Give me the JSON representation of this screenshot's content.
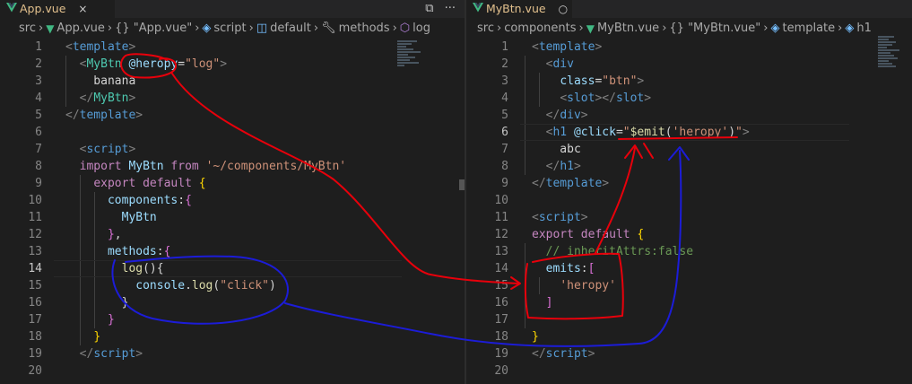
{
  "left": {
    "tab": {
      "label": "App.vue",
      "close": "×"
    },
    "actions": {
      "split": "⧉",
      "more": "···"
    },
    "breadcrumb": [
      "src",
      "App.vue",
      "{} \"App.vue\"",
      "script",
      "default",
      "methods",
      "log"
    ],
    "lines": [
      {
        "n": "1",
        "parts": [
          [
            "t-br",
            "<"
          ],
          [
            "t-tag",
            "template"
          ],
          [
            "t-br",
            ">"
          ]
        ]
      },
      {
        "n": "2",
        "parts": [
          [
            "t-txt",
            "  "
          ],
          [
            "t-br",
            "<"
          ],
          [
            "t-cmp",
            "MyBtn"
          ],
          [
            "t-txt",
            " "
          ],
          [
            "t-at",
            "@heropy"
          ],
          [
            "t-txt",
            "="
          ],
          [
            "t-str",
            "\"log\""
          ],
          [
            "t-br",
            ">"
          ]
        ]
      },
      {
        "n": "3",
        "parts": [
          [
            "t-txt",
            "    banana"
          ]
        ]
      },
      {
        "n": "4",
        "parts": [
          [
            "t-txt",
            "  "
          ],
          [
            "t-br",
            "</"
          ],
          [
            "t-cmp",
            "MyBtn"
          ],
          [
            "t-br",
            ">"
          ]
        ]
      },
      {
        "n": "5",
        "parts": [
          [
            "t-br",
            "</"
          ],
          [
            "t-tag",
            "template"
          ],
          [
            "t-br",
            ">"
          ]
        ]
      },
      {
        "n": "6",
        "parts": []
      },
      {
        "n": "7",
        "parts": [
          [
            "t-txt",
            "  "
          ],
          [
            "t-br",
            "<"
          ],
          [
            "t-tag",
            "script"
          ],
          [
            "t-br",
            ">"
          ]
        ]
      },
      {
        "n": "8",
        "parts": [
          [
            "t-txt",
            "  "
          ],
          [
            "t-kw",
            "import"
          ],
          [
            "t-txt",
            " "
          ],
          [
            "t-at",
            "MyBtn"
          ],
          [
            "t-txt",
            " "
          ],
          [
            "t-kw",
            "from"
          ],
          [
            "t-txt",
            " "
          ],
          [
            "t-str",
            "'~/components/MyBtn'"
          ]
        ]
      },
      {
        "n": "9",
        "parts": [
          [
            "t-txt",
            "    "
          ],
          [
            "t-kw",
            "export"
          ],
          [
            "t-txt",
            " "
          ],
          [
            "t-kw",
            "default"
          ],
          [
            "t-txt",
            " "
          ],
          [
            "t-yel",
            "{"
          ]
        ]
      },
      {
        "n": "10",
        "parts": [
          [
            "t-txt",
            "      "
          ],
          [
            "t-at",
            "components"
          ],
          [
            "t-txt",
            ":"
          ],
          [
            "t-pur",
            "{"
          ]
        ]
      },
      {
        "n": "11",
        "parts": [
          [
            "t-txt",
            "        "
          ],
          [
            "t-at",
            "MyBtn"
          ]
        ]
      },
      {
        "n": "12",
        "parts": [
          [
            "t-txt",
            "      "
          ],
          [
            "t-pur",
            "}"
          ],
          [
            "t-txt",
            ","
          ]
        ]
      },
      {
        "n": "13",
        "parts": [
          [
            "t-txt",
            "      "
          ],
          [
            "t-at",
            "methods"
          ],
          [
            "t-txt",
            ":"
          ],
          [
            "t-pur",
            "{"
          ]
        ]
      },
      {
        "n": "14",
        "parts": [
          [
            "t-txt",
            "        "
          ],
          [
            "t-fn",
            "log"
          ],
          [
            "t-txt",
            "(){"
          ]
        ],
        "hl": true
      },
      {
        "n": "15",
        "parts": [
          [
            "t-txt",
            "          "
          ],
          [
            "t-at",
            "console"
          ],
          [
            "t-txt",
            "."
          ],
          [
            "t-fn",
            "log"
          ],
          [
            "t-txt",
            "("
          ],
          [
            "t-str",
            "\"click\""
          ],
          [
            "t-txt",
            ")"
          ]
        ]
      },
      {
        "n": "16",
        "parts": [
          [
            "t-txt",
            "        }"
          ]
        ]
      },
      {
        "n": "17",
        "parts": [
          [
            "t-txt",
            "      "
          ],
          [
            "t-pur",
            "}"
          ]
        ]
      },
      {
        "n": "18",
        "parts": [
          [
            "t-txt",
            "    "
          ],
          [
            "t-yel",
            "}"
          ]
        ]
      },
      {
        "n": "19",
        "parts": [
          [
            "t-txt",
            "  "
          ],
          [
            "t-br",
            "</"
          ],
          [
            "t-tag",
            "script"
          ],
          [
            "t-br",
            ">"
          ]
        ]
      },
      {
        "n": "20",
        "parts": []
      }
    ]
  },
  "right": {
    "tab": {
      "label": "MyBtn.vue",
      "close": "○"
    },
    "breadcrumb": [
      "src",
      "components",
      "MyBtn.vue",
      "{} \"MyBtn.vue\"",
      "template",
      "h1"
    ],
    "lines": [
      {
        "n": "1",
        "parts": [
          [
            "t-br",
            "<"
          ],
          [
            "t-tag",
            "template"
          ],
          [
            "t-br",
            ">"
          ]
        ]
      },
      {
        "n": "2",
        "parts": [
          [
            "t-txt",
            "  "
          ],
          [
            "t-br",
            "<"
          ],
          [
            "t-tag",
            "div"
          ]
        ]
      },
      {
        "n": "3",
        "parts": [
          [
            "t-txt",
            "    "
          ],
          [
            "t-at",
            "class"
          ],
          [
            "t-txt",
            "="
          ],
          [
            "t-str",
            "\"btn\""
          ],
          [
            "t-br",
            ">"
          ]
        ]
      },
      {
        "n": "4",
        "parts": [
          [
            "t-txt",
            "    "
          ],
          [
            "t-br",
            "<"
          ],
          [
            "t-tag",
            "slot"
          ],
          [
            "t-br",
            "></"
          ],
          [
            "t-tag",
            "slot"
          ],
          [
            "t-br",
            ">"
          ]
        ]
      },
      {
        "n": "5",
        "parts": [
          [
            "t-txt",
            "  "
          ],
          [
            "t-br",
            "</"
          ],
          [
            "t-tag",
            "div"
          ],
          [
            "t-br",
            ">"
          ]
        ]
      },
      {
        "n": "6",
        "parts": [
          [
            "t-txt",
            "  "
          ],
          [
            "t-br",
            "<"
          ],
          [
            "t-tag",
            "h1"
          ],
          [
            "t-txt",
            " "
          ],
          [
            "t-at",
            "@click"
          ],
          [
            "t-txt",
            "="
          ],
          [
            "t-str",
            "\""
          ],
          [
            "t-fn",
            "$emit"
          ],
          [
            "t-txt",
            "("
          ],
          [
            "t-str",
            "'heropy'"
          ],
          [
            "t-txt",
            ")"
          ],
          [
            "t-str",
            "\""
          ],
          [
            "t-br",
            ">"
          ]
        ],
        "hl": true
      },
      {
        "n": "7",
        "parts": [
          [
            "t-txt",
            "    abc"
          ]
        ]
      },
      {
        "n": "8",
        "parts": [
          [
            "t-txt",
            "  "
          ],
          [
            "t-br",
            "</"
          ],
          [
            "t-tag",
            "h1"
          ],
          [
            "t-br",
            ">"
          ]
        ]
      },
      {
        "n": "9",
        "parts": [
          [
            "t-br",
            "</"
          ],
          [
            "t-tag",
            "template"
          ],
          [
            "t-br",
            ">"
          ]
        ]
      },
      {
        "n": "10",
        "parts": []
      },
      {
        "n": "11",
        "parts": [
          [
            "t-br",
            "<"
          ],
          [
            "t-tag",
            "script"
          ],
          [
            "t-br",
            ">"
          ]
        ]
      },
      {
        "n": "12",
        "parts": [
          [
            "t-kw",
            "export"
          ],
          [
            "t-txt",
            " "
          ],
          [
            "t-kw",
            "default"
          ],
          [
            "t-txt",
            " "
          ],
          [
            "t-yel",
            "{"
          ]
        ]
      },
      {
        "n": "13",
        "parts": [
          [
            "t-txt",
            "  "
          ],
          [
            "t-com",
            "// inheritAttrs:false"
          ]
        ]
      },
      {
        "n": "14",
        "parts": [
          [
            "t-txt",
            "  "
          ],
          [
            "t-at",
            "emits"
          ],
          [
            "t-txt",
            ":"
          ],
          [
            "t-pur",
            "["
          ]
        ]
      },
      {
        "n": "15",
        "parts": [
          [
            "t-txt",
            "    "
          ],
          [
            "t-str",
            "'heropy'"
          ]
        ]
      },
      {
        "n": "16",
        "parts": [
          [
            "t-txt",
            "  "
          ],
          [
            "t-pur",
            "]"
          ]
        ]
      },
      {
        "n": "17",
        "parts": []
      },
      {
        "n": "18",
        "parts": [
          [
            "t-yel",
            "}"
          ]
        ]
      },
      {
        "n": "19",
        "parts": [
          [
            "t-br",
            "</"
          ],
          [
            "t-tag",
            "script"
          ],
          [
            "t-br",
            ">"
          ]
        ]
      },
      {
        "n": "20",
        "parts": []
      }
    ]
  },
  "colors": {
    "background": "#1e1e1e",
    "annotation_red": "#e8000b",
    "annotation_blue": "#1c1cd8",
    "vue_green": "#41b883"
  }
}
